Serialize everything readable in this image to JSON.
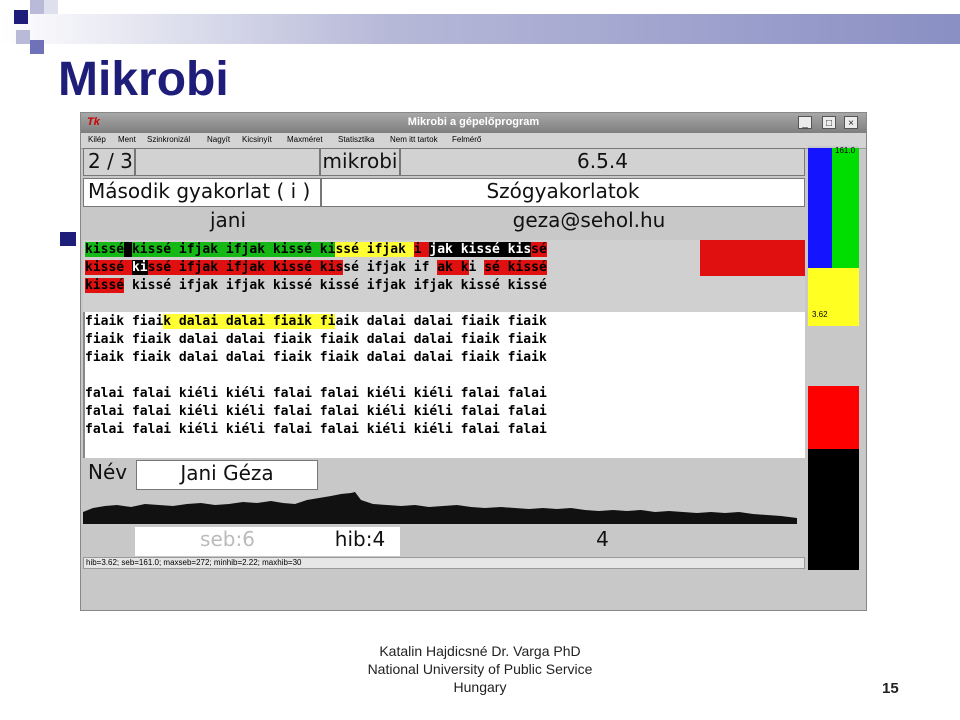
{
  "slide": {
    "title": "Mikrobi",
    "footer_lines": [
      "Katalin Hajdicsné Dr. Varga PhD",
      "National University of Public Service",
      "Hungary"
    ],
    "page_number": "15"
  },
  "window": {
    "title": "Mikrobi a gépelőprogram",
    "app_icon": "Tk",
    "buttons": {
      "minimize": "_",
      "maximize": "□",
      "close": "×"
    }
  },
  "menu": [
    "Kilép",
    "Ment",
    "Szinkronizál",
    "Nagyít",
    "Kicsinyít",
    "Maxméret",
    "Statisztika",
    "Nem itt tartok",
    "Felmérő"
  ],
  "header": {
    "progress": "2 / 3",
    "program": "mikrobi",
    "version": "6.5.4",
    "exercise": "Második gyakorlat ( i )",
    "exercise_type": "Szógyakorlatok",
    "user": "jani",
    "email": "geza@sehol.hu"
  },
  "text_lines": [
    [
      [
        "kissé",
        "#16b816"
      ],
      [
        " ",
        "#000"
      ],
      [
        "kissé ifjak ifjak kissé ki",
        "#16b816"
      ],
      [
        "ssé ifjak ",
        "#ffff33"
      ],
      [
        "i ",
        "#e01010"
      ],
      [
        "jak kissé kis",
        "#000"
      ],
      [
        "sé",
        "#e01010"
      ]
    ],
    [
      [
        "kissé ",
        "#e01010"
      ],
      [
        "ki",
        "#000"
      ],
      [
        "ssé ifjak ifjak kissé kis",
        "#e01010"
      ],
      [
        "sé ifjak if ",
        "#d0d0d0"
      ],
      [
        "ak k",
        "#e01010"
      ],
      [
        "i ",
        "#d0d0d0"
      ],
      [
        "sé kissé",
        "#e01010"
      ]
    ],
    [
      [
        "kissé",
        "#e01010"
      ],
      [
        " kissé ifjak ifjak kissé kissé ifjak ifjak kissé kissé",
        "#d0d0d0"
      ]
    ],
    [
      [
        "",
        "#fff"
      ]
    ],
    [
      [
        "fiaik fiai",
        "#fff"
      ],
      [
        "k dalai dalai fiaik fi",
        "#ffff33"
      ],
      [
        "aik dalai dalai fiaik fiaik",
        "#fff"
      ]
    ],
    [
      [
        "fiaik fiaik dalai dalai fiaik fiaik dalai dalai fiaik fiaik",
        "#fff"
      ]
    ],
    [
      [
        "fiaik fiaik dalai dalai fiaik fiaik dalai dalai fiaik fiaik",
        "#fff"
      ]
    ],
    [
      [
        "",
        "#fff"
      ]
    ],
    [
      [
        "falai falai kiéli kiéli falai falai kiéli kiéli falai falai",
        "#fff"
      ]
    ],
    [
      [
        "falai falai kiéli kiéli falai falai kiéli kiéli falai falai",
        "#fff"
      ]
    ],
    [
      [
        "falai falai kiéli kiéli falai falai kiéli kiéli falai falai",
        "#fff"
      ]
    ]
  ],
  "name_label": "Név",
  "name_value": "Jani Géza",
  "speed": "seb:6",
  "errors": "hib:4",
  "counter": "4",
  "status_line": "hib=3.62; seb=161.0; maxseb=272; minhib=2.22; maxhib=30",
  "side_meter": {
    "top_value": "161.0",
    "mid_value": "3.62"
  },
  "colors": {
    "blue": "#1414ff",
    "green": "#00dd00",
    "yellow": "#ffff22",
    "red": "#ff0000",
    "black": "#000000",
    "title": "#1f1d7a"
  }
}
